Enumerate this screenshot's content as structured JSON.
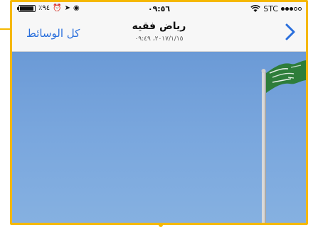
{
  "status_bar": {
    "battery_percent": "٪٩٤",
    "battery_level": 0.94,
    "time": "٠٩:٥٦",
    "carrier": "STC",
    "signal_bars": 3,
    "signal_total": 5
  },
  "nav": {
    "back_label": "كل الوسائط",
    "title": "رياض فقيه",
    "subtitle": "٢٠١٧/١/١٥، ٠٩:٤٩",
    "accent_color": "#2a6fdc"
  },
  "photo": {
    "description_icon": "saudi-flag-on-pole",
    "sky_color": "#79a6dd",
    "flag_color": "#2e7d3a"
  },
  "frame_color": "#f5b800"
}
